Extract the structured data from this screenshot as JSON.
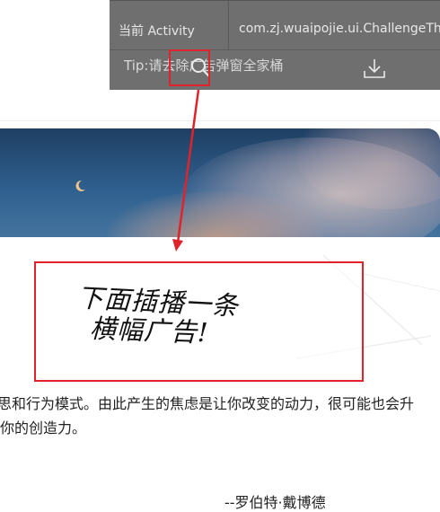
{
  "overlay": {
    "label": "当前 Activity",
    "value": "com.zj.wuaipojie.ui.ChallengeThird",
    "tip": "Tip:请去除广告弹窗全家桶",
    "search_icon": "search-icon",
    "download_icon": "download-icon"
  },
  "note": {
    "line1": "下面插播一条",
    "line2": "横幅广告!"
  },
  "article": {
    "line1": "思和行为模式。由此产生的焦虑是让你改变的动力，很可能也会升",
    "line2": "你的创造力。",
    "author": "--罗伯特·戴博德"
  },
  "colors": {
    "overlay_bg": "#6f6f6f",
    "highlight_red": "#e0232b"
  }
}
